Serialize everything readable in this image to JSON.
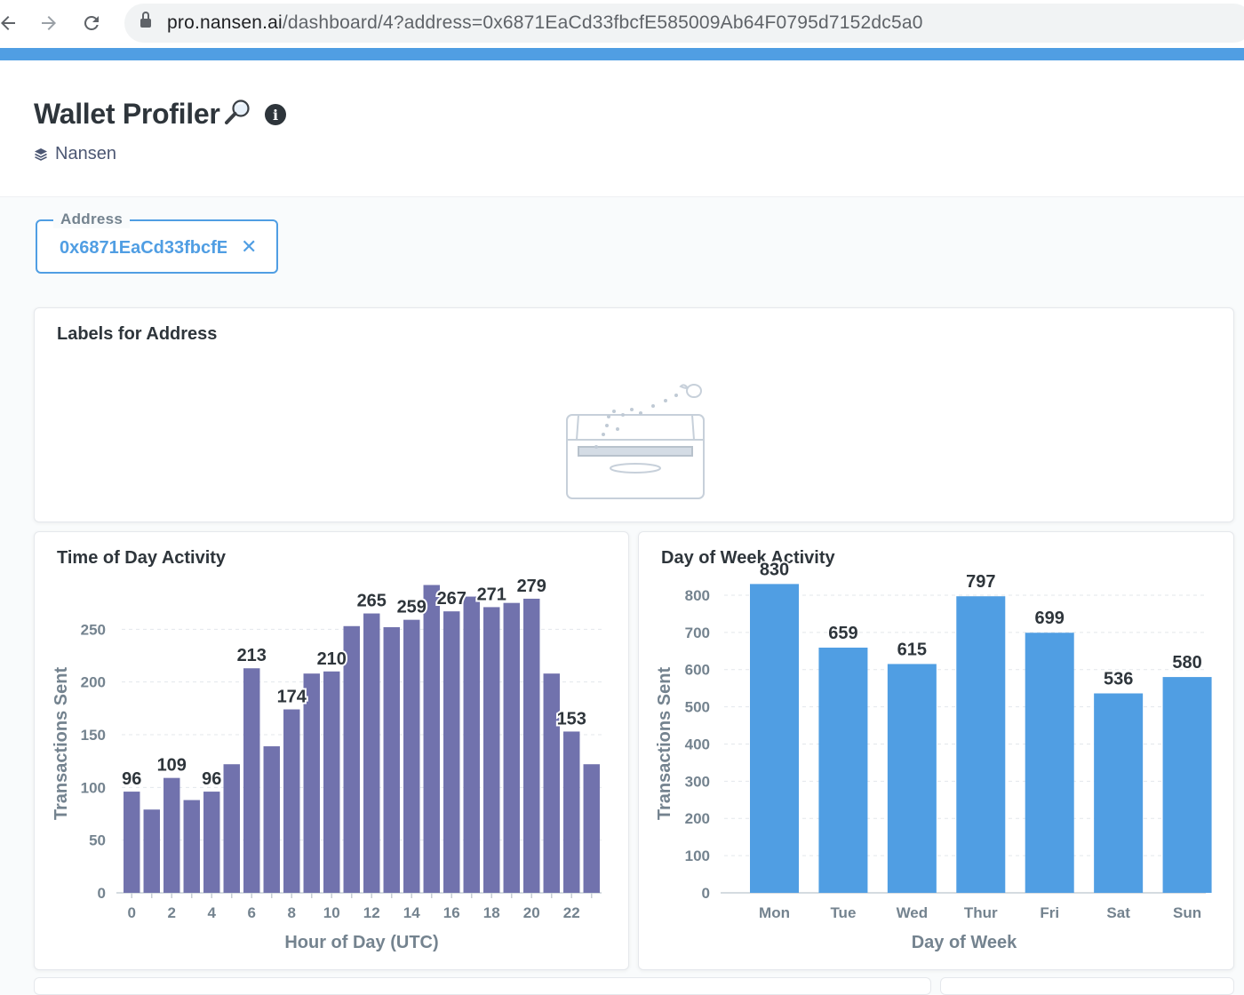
{
  "browser": {
    "url_host": "pro.nansen.ai",
    "url_path": "/dashboard/4?address=0x6871EaCd33fbcfE585009Ab64F0795d7152dc5a0",
    "icons": [
      "back-arrow-icon",
      "forward-arrow-icon",
      "reload-icon",
      "lock-icon"
    ]
  },
  "dashboard": {
    "title": "Wallet Profiler",
    "title_icon": "magnifying-glass-icon",
    "info_icon": "info-circle-icon",
    "collection": "Nansen"
  },
  "filter": {
    "label": "Address",
    "value": "0x6871EaCd33fbcfE585009Ab64F0795d7152dc5a0"
  },
  "cards": {
    "labels": {
      "title": "Labels for Address",
      "empty_icon": "empty-box-illustration"
    },
    "time_of_day": {
      "title": "Time of Day Activity"
    },
    "day_of_week": {
      "title": "Day of Week Activity"
    }
  },
  "colors": {
    "accent": "#509ee3",
    "time_bars": "#7172ad",
    "day_bars": "#509ee3"
  },
  "chart_data": [
    {
      "type": "bar",
      "xlabel": "Hour of Day (UTC)",
      "ylabel": "Transactions Sent",
      "x": [
        0,
        1,
        2,
        3,
        4,
        5,
        6,
        7,
        8,
        9,
        10,
        11,
        12,
        13,
        14,
        15,
        16,
        17,
        18,
        19,
        20,
        21,
        22,
        23
      ],
      "x_ticks": [
        "0",
        "2",
        "4",
        "6",
        "8",
        "10",
        "12",
        "14",
        "16",
        "18",
        "20",
        "22"
      ],
      "values": [
        96,
        79,
        109,
        88,
        96,
        122,
        213,
        139,
        174,
        208,
        210,
        253,
        265,
        252,
        259,
        292,
        267,
        281,
        271,
        275,
        279,
        208,
        153,
        122
      ],
      "data_labels": {
        "0": 96,
        "2": 109,
        "4": 96,
        "6": 213,
        "8": 174,
        "10": 210,
        "12": 265,
        "14": 259,
        "16": 267,
        "18": 271,
        "20": 279,
        "22": 153
      },
      "ylim": [
        0,
        300
      ],
      "y_ticks": [
        0,
        50,
        100,
        150,
        200,
        250
      ],
      "grid": true
    },
    {
      "type": "bar",
      "xlabel": "Day of Week",
      "ylabel": "Transactions Sent",
      "categories": [
        "Mon",
        "Tue",
        "Wed",
        "Thur",
        "Fri",
        "Sat",
        "Sun"
      ],
      "values": [
        830,
        659,
        615,
        797,
        699,
        536,
        580
      ],
      "ylim": [
        0,
        850
      ],
      "y_ticks": [
        0,
        100,
        200,
        300,
        400,
        500,
        600,
        700,
        800
      ],
      "grid": true
    }
  ]
}
